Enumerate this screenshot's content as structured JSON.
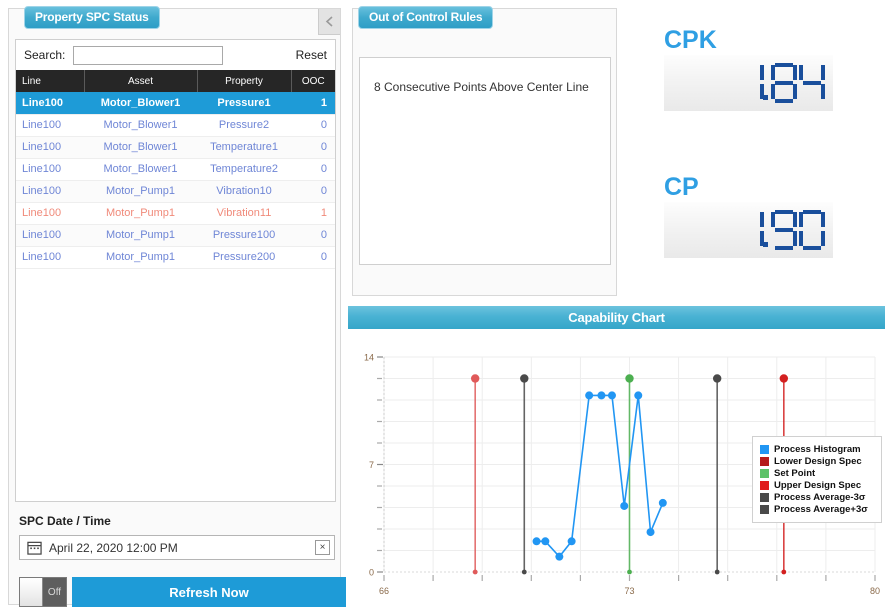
{
  "left_panel": {
    "title": "Property SPC Status",
    "collapse_icon": "chevron-left-icon",
    "search": {
      "label": "Search:",
      "value": "",
      "placeholder": ""
    },
    "reset_label": "Reset",
    "columns": [
      "Line",
      "Asset",
      "Property",
      "OOC"
    ],
    "rows": [
      {
        "line": "Line100",
        "asset": "Motor_Blower1",
        "property": "Pressure1",
        "ooc": "1",
        "state": "selected"
      },
      {
        "line": "Line100",
        "asset": "Motor_Blower1",
        "property": "Pressure2",
        "ooc": "0",
        "state": "normal"
      },
      {
        "line": "Line100",
        "asset": "Motor_Blower1",
        "property": "Temperature1",
        "ooc": "0",
        "state": "normal"
      },
      {
        "line": "Line100",
        "asset": "Motor_Blower1",
        "property": "Temperature2",
        "ooc": "0",
        "state": "normal"
      },
      {
        "line": "Line100",
        "asset": "Motor_Pump1",
        "property": "Vibration10",
        "ooc": "0",
        "state": "normal"
      },
      {
        "line": "Line100",
        "asset": "Motor_Pump1",
        "property": "Vibration11",
        "ooc": "1",
        "state": "alarm"
      },
      {
        "line": "Line100",
        "asset": "Motor_Pump1",
        "property": "Pressure100",
        "ooc": "0",
        "state": "normal"
      },
      {
        "line": "Line100",
        "asset": "Motor_Pump1",
        "property": "Pressure200",
        "ooc": "0",
        "state": "normal"
      }
    ],
    "date_section": {
      "label": "SPC Date / Time",
      "value": "April 22, 2020 12:00 PM",
      "calendar_icon": "calendar-icon",
      "clear_icon": "close-icon",
      "clear_label": "×"
    },
    "toggle": {
      "state_label": "Off",
      "checked": false
    },
    "refresh_label": "Refresh Now"
  },
  "ooc_panel": {
    "title": "Out of Control Rules",
    "rules": [
      "8 Consecutive Points Above Center Line"
    ]
  },
  "gauges": [
    {
      "label": "CPK",
      "value": "1.84",
      "digits": [
        "1",
        ".",
        "8",
        "4"
      ]
    },
    {
      "label": "CP",
      "value": "1.90",
      "digits": [
        "1",
        ".",
        "9",
        "0"
      ]
    }
  ],
  "colors": {
    "accent_blue": "#1e9bd7",
    "gauge_label": "#2f9fe3",
    "gauge_digit": "#1a4f9c",
    "alarm_red": "#f08a7a",
    "row_link": "#6f86d6"
  },
  "chart_data": {
    "type": "line",
    "title": "Capability Chart",
    "xlabel": "",
    "ylabel": "",
    "xlim": [
      66,
      80
    ],
    "ylim": [
      0,
      14
    ],
    "xticks": [
      66,
      73,
      80
    ],
    "yticks": [
      0,
      7,
      14
    ],
    "grid": true,
    "legend_position": "right",
    "series": [
      {
        "name": "Process Histogram",
        "color": "#2196f3",
        "type": "line",
        "x": [
          70.35,
          70.6,
          71.0,
          71.35,
          71.85,
          72.2,
          72.5,
          72.85,
          73.25,
          73.6,
          73.95
        ],
        "y": [
          2.0,
          2.0,
          1.0,
          2.0,
          11.5,
          11.5,
          11.5,
          4.3,
          11.5,
          2.6,
          4.5
        ]
      },
      {
        "name": "Lower Design Spec",
        "color": "#e05a5a",
        "type": "vline",
        "x": [
          68.6
        ],
        "y_top": 12.6
      },
      {
        "name": "Set Point",
        "color": "#4caf50",
        "type": "vline",
        "x": [
          73.0
        ],
        "y_top": 12.6
      },
      {
        "name": "Upper Design Spec",
        "color": "#d32020",
        "type": "vline",
        "x": [
          77.4
        ],
        "y_top": 12.6
      },
      {
        "name": "Process Average-3σ",
        "color": "#4a4a4a",
        "type": "vline",
        "x": [
          70.0
        ],
        "y_top": 12.6
      },
      {
        "name": "Process Average+3σ",
        "color": "#4a4a4a",
        "type": "vline",
        "x": [
          75.5
        ],
        "y_top": 12.6
      }
    ],
    "legend": [
      {
        "label": "Process Histogram",
        "color": "#2196f3"
      },
      {
        "label": "Lower Design Spec",
        "color": "#b51b1b"
      },
      {
        "label": "Set Point",
        "color": "#5cc268"
      },
      {
        "label": "Upper Design Spec",
        "color": "#e01b1b"
      },
      {
        "label": "Process Average-3σ",
        "color": "#4a4a4a"
      },
      {
        "label": "Process Average+3σ",
        "color": "#4a4a4a"
      }
    ]
  }
}
